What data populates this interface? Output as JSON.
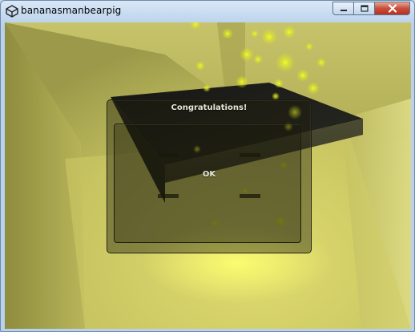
{
  "window": {
    "title": "bananasmanbearpig",
    "logo_icon": "unity-logo-icon",
    "minimize_icon": "minimize-icon",
    "maximize_icon": "maximize-icon",
    "close_icon": "close-icon"
  },
  "game": {
    "scene_icon": "3d-scene",
    "colors": {
      "ambient": "#d9d66a",
      "glow": "#e4e030",
      "particles": "#e6ec22",
      "dark_slab": "#1e1e1c"
    }
  },
  "dialog": {
    "title": "Congratulations!",
    "ok_label": "OK"
  }
}
